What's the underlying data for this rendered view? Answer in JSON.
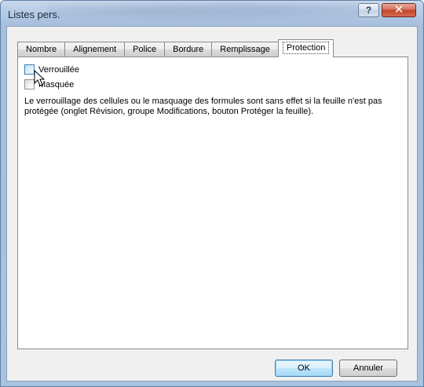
{
  "window": {
    "title": "Listes pers.",
    "help_glyph": "?",
    "close_glyph": "✕"
  },
  "tabs": [
    {
      "label": "Nombre"
    },
    {
      "label": "Alignement"
    },
    {
      "label": "Police"
    },
    {
      "label": "Bordure"
    },
    {
      "label": "Remplissage"
    },
    {
      "label": "Protection",
      "active": true
    }
  ],
  "protection": {
    "locked_label": "Verrouillée",
    "locked_checked": false,
    "hidden_label": "Masquée",
    "hidden_checked": false,
    "description": "Le verrouillage des cellules ou le masquage des formules sont sans effet si la feuille n'est pas protégée (onglet Révision, groupe Modifications, bouton Protéger la feuille)."
  },
  "buttons": {
    "ok_label": "OK",
    "cancel_label": "Annuler"
  },
  "colors": {
    "title_bar": "#a9c1df",
    "close_button": "#c4442a",
    "default_button_border": "#3c7fb1"
  },
  "icons": {
    "cursor": "arrow-cursor-icon"
  }
}
